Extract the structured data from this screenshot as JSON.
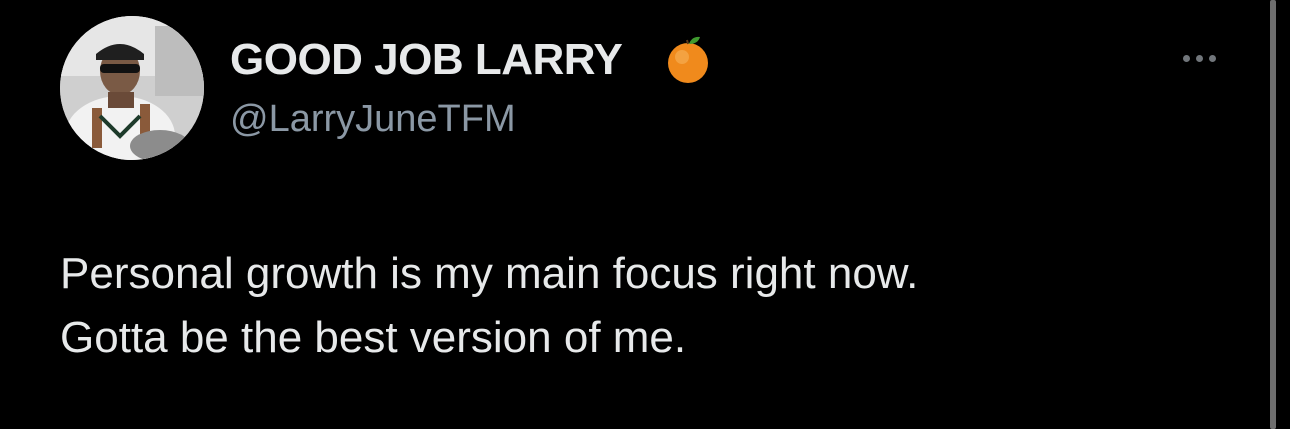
{
  "tweet": {
    "author": {
      "display_name": "GOOD JOB LARRY",
      "badge_icon": "orange-emoji-icon",
      "handle": "@LarryJuneTFM",
      "avatar_icon": "profile-avatar"
    },
    "text_lines": [
      "Personal growth is my main focus right now.",
      "Gotta be the best version of me."
    ],
    "menu_icon": "more-options-icon"
  },
  "colors": {
    "background": "#000000",
    "primary_text": "#e7e9ea",
    "secondary_text": "#8b98a5",
    "menu_dots": "#71767b"
  }
}
